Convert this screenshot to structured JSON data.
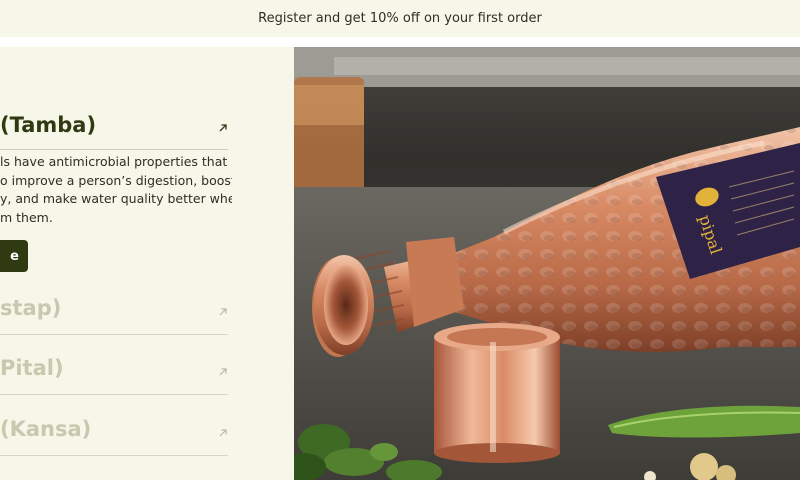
{
  "announcement": {
    "text": "Register and get 10% off on your first order"
  },
  "materials": {
    "active": {
      "title": "(Tamba)",
      "description_lines": [
        "ls have antimicrobial properties that",
        "o improve a person’s digestion, boost",
        "y, and make water quality better when",
        "m them."
      ],
      "cta_label": "e"
    },
    "others": [
      {
        "title": "stap)"
      },
      {
        "title": "Pital)"
      },
      {
        "title": "(Kansa)"
      }
    ]
  },
  "photo": {
    "label_brand": "pipal",
    "icon": "copper-bottle-photo"
  },
  "colors": {
    "accent": "#2f3a13",
    "muted_text": "#c6c9ad",
    "background": "#f6f6e9"
  }
}
